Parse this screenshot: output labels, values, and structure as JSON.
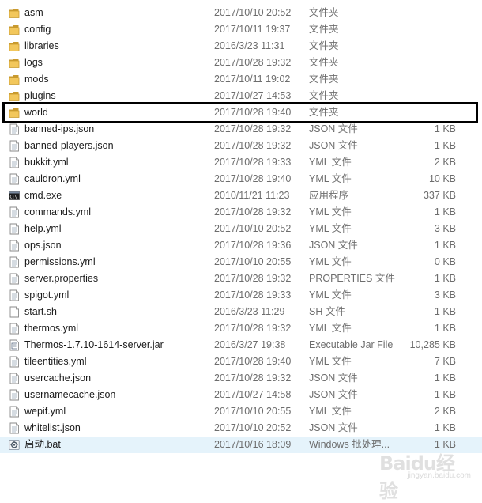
{
  "files": [
    {
      "name": "asm",
      "date": "2017/10/10 20:52",
      "type": "文件夹",
      "size": "",
      "icon": "folder-icon"
    },
    {
      "name": "config",
      "date": "2017/10/11 19:37",
      "type": "文件夹",
      "size": "",
      "icon": "folder-icon"
    },
    {
      "name": "libraries",
      "date": "2016/3/23 11:31",
      "type": "文件夹",
      "size": "",
      "icon": "folder-icon"
    },
    {
      "name": "logs",
      "date": "2017/10/28 19:32",
      "type": "文件夹",
      "size": "",
      "icon": "folder-icon"
    },
    {
      "name": "mods",
      "date": "2017/10/11 19:02",
      "type": "文件夹",
      "size": "",
      "icon": "folder-icon"
    },
    {
      "name": "plugins",
      "date": "2017/10/27 14:53",
      "type": "文件夹",
      "size": "",
      "icon": "folder-icon"
    },
    {
      "name": "world",
      "date": "2017/10/28 19:40",
      "type": "文件夹",
      "size": "",
      "icon": "folder-icon",
      "highlighted": true
    },
    {
      "name": "banned-ips.json",
      "date": "2017/10/28 19:32",
      "type": "JSON 文件",
      "size": "1 KB",
      "icon": "file-icon"
    },
    {
      "name": "banned-players.json",
      "date": "2017/10/28 19:32",
      "type": "JSON 文件",
      "size": "1 KB",
      "icon": "file-icon"
    },
    {
      "name": "bukkit.yml",
      "date": "2017/10/28 19:33",
      "type": "YML 文件",
      "size": "2 KB",
      "icon": "file-icon"
    },
    {
      "name": "cauldron.yml",
      "date": "2017/10/28 19:40",
      "type": "YML 文件",
      "size": "10 KB",
      "icon": "file-icon"
    },
    {
      "name": "cmd.exe",
      "date": "2010/11/21 11:23",
      "type": "应用程序",
      "size": "337 KB",
      "icon": "console-icon"
    },
    {
      "name": "commands.yml",
      "date": "2017/10/28 19:32",
      "type": "YML 文件",
      "size": "1 KB",
      "icon": "file-icon"
    },
    {
      "name": "help.yml",
      "date": "2017/10/10 20:52",
      "type": "YML 文件",
      "size": "3 KB",
      "icon": "file-icon"
    },
    {
      "name": "ops.json",
      "date": "2017/10/28 19:36",
      "type": "JSON 文件",
      "size": "1 KB",
      "icon": "file-icon"
    },
    {
      "name": "permissions.yml",
      "date": "2017/10/10 20:55",
      "type": "YML 文件",
      "size": "0 KB",
      "icon": "file-icon"
    },
    {
      "name": "server.properties",
      "date": "2017/10/28 19:32",
      "type": "PROPERTIES 文件",
      "size": "1 KB",
      "icon": "file-icon"
    },
    {
      "name": "spigot.yml",
      "date": "2017/10/28 19:33",
      "type": "YML 文件",
      "size": "3 KB",
      "icon": "file-icon"
    },
    {
      "name": "start.sh",
      "date": "2016/3/23 11:29",
      "type": "SH 文件",
      "size": "1 KB",
      "icon": "blank-file-icon"
    },
    {
      "name": "thermos.yml",
      "date": "2017/10/28 19:32",
      "type": "YML 文件",
      "size": "1 KB",
      "icon": "file-icon"
    },
    {
      "name": "Thermos-1.7.10-1614-server.jar",
      "date": "2016/3/27 19:38",
      "type": "Executable Jar File",
      "size": "10,285 KB",
      "icon": "jar-icon"
    },
    {
      "name": "tileentities.yml",
      "date": "2017/10/28 19:40",
      "type": "YML 文件",
      "size": "7 KB",
      "icon": "file-icon"
    },
    {
      "name": "usercache.json",
      "date": "2017/10/28 19:32",
      "type": "JSON 文件",
      "size": "1 KB",
      "icon": "file-icon"
    },
    {
      "name": "usernamecache.json",
      "date": "2017/10/27 14:58",
      "type": "JSON 文件",
      "size": "1 KB",
      "icon": "file-icon"
    },
    {
      "name": "wepif.yml",
      "date": "2017/10/10 20:55",
      "type": "YML 文件",
      "size": "2 KB",
      "icon": "file-icon"
    },
    {
      "name": "whitelist.json",
      "date": "2017/10/10 20:52",
      "type": "JSON 文件",
      "size": "1 KB",
      "icon": "file-icon"
    },
    {
      "name": "启动.bat",
      "date": "2017/10/16 18:09",
      "type": "Windows 批处理...",
      "size": "1 KB",
      "icon": "batch-gear-icon",
      "hover": true
    }
  ],
  "watermark": {
    "logo": "Baidu经验",
    "sub": "jingyan.baidu.com"
  },
  "colors": {
    "folder": "#e8b84a",
    "highlight_border": "#000000",
    "hover_bg": "#e5f3fb",
    "meta_text": "#6d6d6d"
  }
}
